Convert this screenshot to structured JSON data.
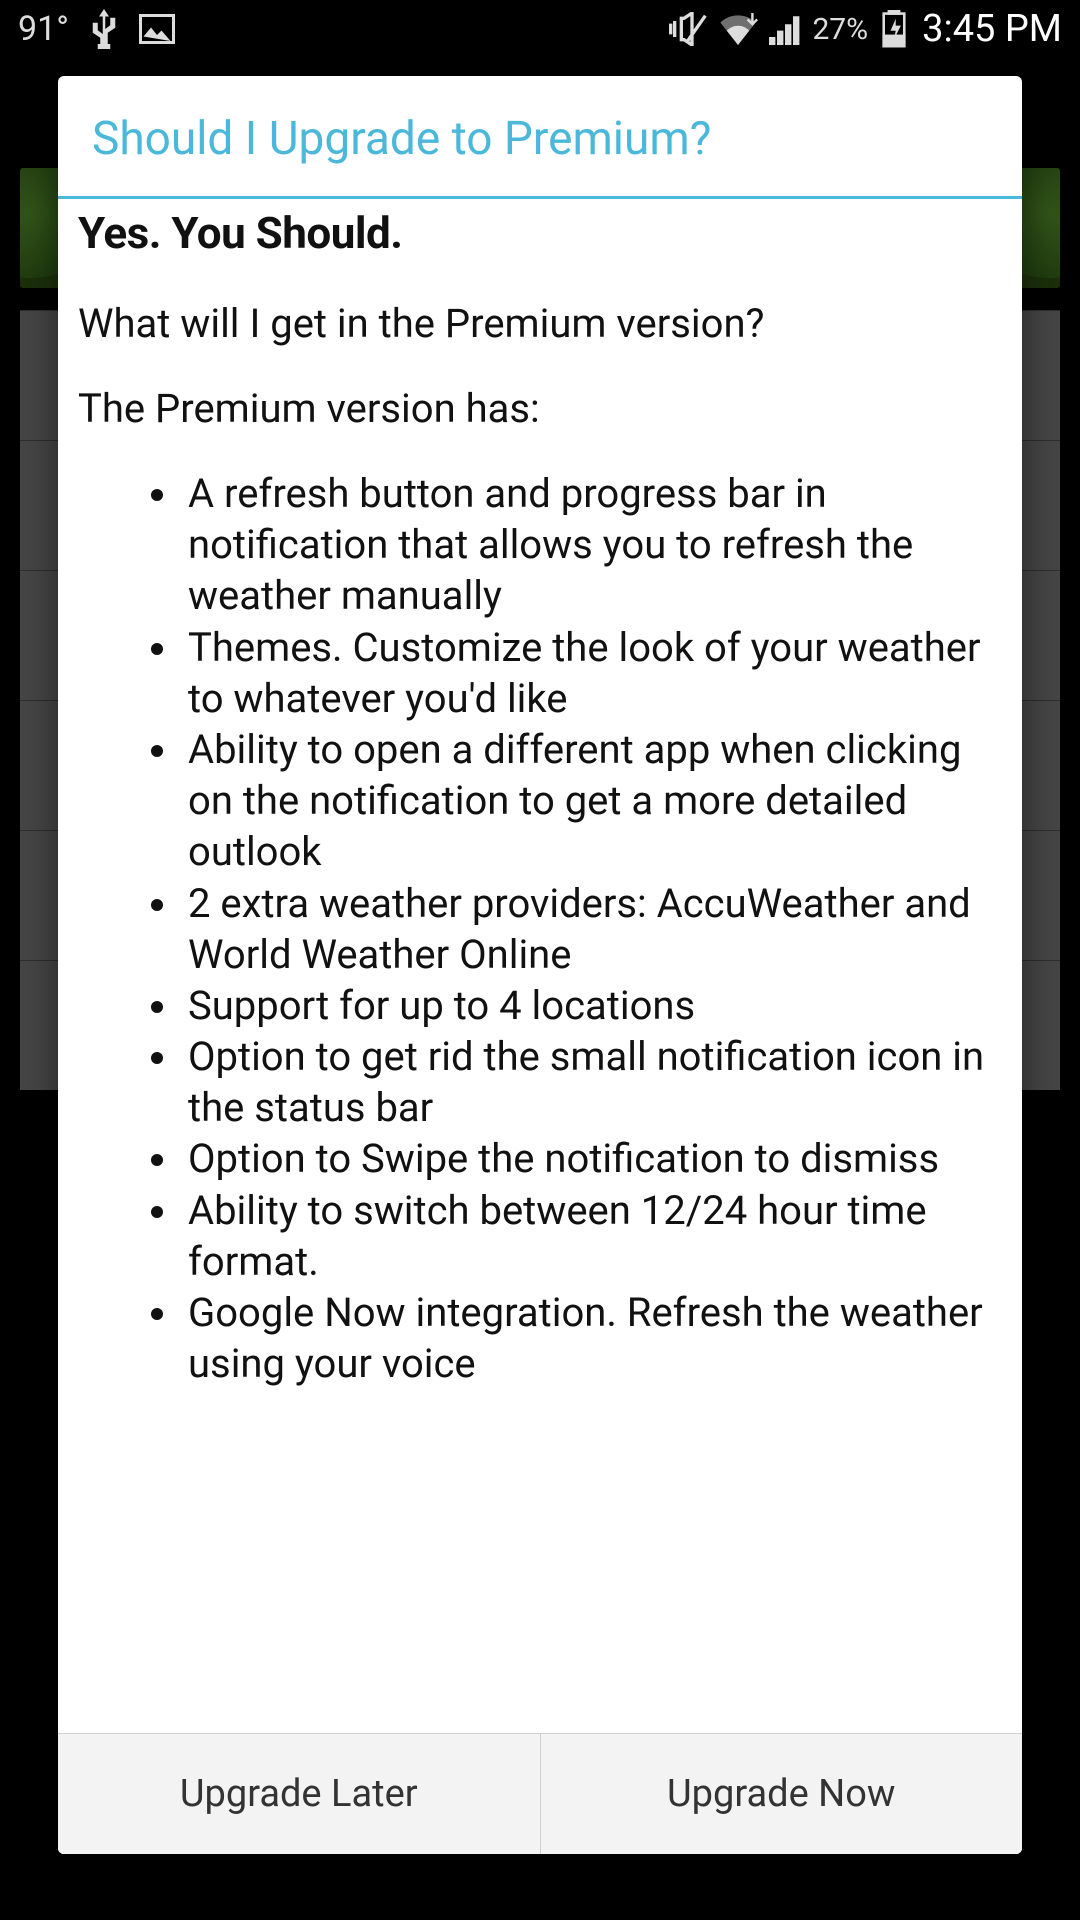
{
  "status_bar": {
    "temperature": "91°",
    "battery_pct": "27%",
    "time": "3:45 PM",
    "icons": {
      "usb": "usb-icon",
      "picture": "picture-icon",
      "vibrate": "vibrate-mute-icon",
      "wifi": "wifi-icon",
      "signal": "signal-icon",
      "battery": "battery-charging-icon"
    }
  },
  "dialog": {
    "title": "Should I Upgrade to Premium?",
    "headline": "Yes. You Should.",
    "subhead": "What will I get in the Premium version?",
    "intro": "The Premium version has:",
    "features": [
      "A refresh button and progress bar in notification that allows you to refresh the weather manually",
      "Themes. Customize the look of your weather to whatever you'd like",
      "Ability to open a different app when clicking on the notification to get a more detailed outlook",
      "2 extra weather providers: AccuWeather and World Weather Online",
      "Support for up to 4 locations",
      "Option to get rid the small notification icon in the status bar",
      "Option to Swipe the notification to dismiss",
      "Ability to switch between 12/24 hour time format.",
      "Google Now integration. Refresh the weather using your voice"
    ],
    "buttons": {
      "later": "Upgrade Later",
      "now": "Upgrade Now"
    }
  }
}
